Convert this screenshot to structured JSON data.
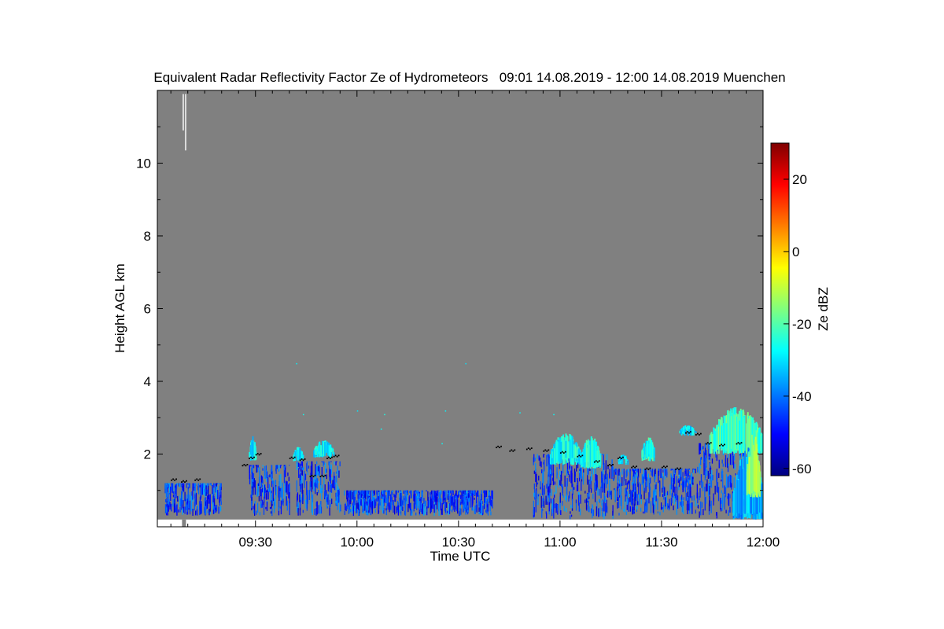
{
  "chart_data": {
    "type": "heatmap",
    "title": "Equivalent Radar Reflectivity Factor Ze of Hydrometeors   09:01 14.08.2019 - 12:00 14.08.2019 Muenchen",
    "xlabel": "Time UTC",
    "ylabel": "Height AGL km",
    "x_ticks": [
      "09:30",
      "10:00",
      "10:30",
      "11:00",
      "11:30",
      "12:00"
    ],
    "x_tick_minutes": [
      570,
      600,
      630,
      660,
      690,
      720
    ],
    "xlim_minutes": [
      541,
      720
    ],
    "y_ticks": [
      2,
      4,
      6,
      8,
      10
    ],
    "ylim": [
      0,
      12
    ],
    "background_color": "#808080",
    "colorbar": {
      "label": "Ze dBZ",
      "range": [
        -62,
        30
      ],
      "ticks": [
        -60,
        -40,
        -20,
        0,
        20
      ],
      "colors": [
        "#00007f",
        "#0000ff",
        "#007fff",
        "#00ffff",
        "#7fff7f",
        "#ffff00",
        "#ff7f00",
        "#ff0000",
        "#7f0000"
      ]
    },
    "echo_features": [
      {
        "t0": 568,
        "t1": 570,
        "h0": 1.8,
        "h1": 2.5,
        "dbz": -28
      },
      {
        "t0": 581,
        "t1": 584,
        "h0": 1.8,
        "h1": 2.2,
        "dbz": -30
      },
      {
        "t0": 587,
        "t1": 593,
        "h0": 1.9,
        "h1": 2.4,
        "dbz": -28
      },
      {
        "t0": 657,
        "t1": 666,
        "h0": 1.7,
        "h1": 2.6,
        "dbz": -27
      },
      {
        "t0": 666,
        "t1": 672,
        "h0": 1.6,
        "h1": 2.5,
        "dbz": -26
      },
      {
        "t0": 677,
        "t1": 680,
        "h0": 1.7,
        "h1": 2.0,
        "dbz": -32
      },
      {
        "t0": 684,
        "t1": 688,
        "h0": 1.8,
        "h1": 2.5,
        "dbz": -25
      },
      {
        "t0": 695,
        "t1": 700,
        "h0": 2.5,
        "h1": 2.8,
        "dbz": -30
      },
      {
        "t0": 704,
        "t1": 720,
        "h0": 2.0,
        "h1": 3.3,
        "dbz": -22
      },
      {
        "t0": 711,
        "t1": 720,
        "h0": 0.2,
        "h1": 2.2,
        "dbz": -35
      },
      {
        "t0": 715,
        "t1": 719,
        "h0": 0.8,
        "h1": 2.6,
        "dbz": -15
      }
    ],
    "drizzle_regions": [
      {
        "t0": 543,
        "t1": 560,
        "h0": 0.3,
        "h1": 1.2
      },
      {
        "t0": 568,
        "t1": 580,
        "h0": 0.3,
        "h1": 1.7
      },
      {
        "t0": 582,
        "t1": 595,
        "h0": 0.3,
        "h1": 1.8
      },
      {
        "t0": 596,
        "t1": 640,
        "h0": 0.3,
        "h1": 1.0
      },
      {
        "t0": 652,
        "t1": 676,
        "h0": 0.2,
        "h1": 2.0
      },
      {
        "t0": 676,
        "t1": 700,
        "h0": 0.3,
        "h1": 1.6
      },
      {
        "t0": 700,
        "t1": 715,
        "h0": 0.2,
        "h1": 2.3
      }
    ],
    "cloud_base": [
      {
        "t": 545,
        "h": 1.3
      },
      {
        "t": 548,
        "h": 1.25
      },
      {
        "t": 552,
        "h": 1.3
      },
      {
        "t": 566,
        "h": 1.7
      },
      {
        "t": 568,
        "h": 1.9
      },
      {
        "t": 570,
        "h": 2.0
      },
      {
        "t": 580,
        "h": 1.9
      },
      {
        "t": 583,
        "h": 1.85
      },
      {
        "t": 586,
        "h": 1.4
      },
      {
        "t": 589,
        "h": 1.4
      },
      {
        "t": 591,
        "h": 1.9
      },
      {
        "t": 593,
        "h": 1.95
      },
      {
        "t": 641,
        "h": 2.2
      },
      {
        "t": 645,
        "h": 2.1
      },
      {
        "t": 650,
        "h": 2.15
      },
      {
        "t": 655,
        "h": 2.1
      },
      {
        "t": 660,
        "h": 2.05
      },
      {
        "t": 665,
        "h": 1.95
      },
      {
        "t": 670,
        "h": 1.8
      },
      {
        "t": 674,
        "h": 1.7
      },
      {
        "t": 677,
        "h": 1.9
      },
      {
        "t": 681,
        "h": 1.65
      },
      {
        "t": 685,
        "h": 1.6
      },
      {
        "t": 690,
        "h": 1.65
      },
      {
        "t": 694,
        "h": 1.6
      },
      {
        "t": 697,
        "h": 2.6
      },
      {
        "t": 700,
        "h": 2.55
      },
      {
        "t": 703,
        "h": 2.3
      },
      {
        "t": 707,
        "h": 2.25
      },
      {
        "t": 712,
        "h": 2.3
      }
    ],
    "lowest_range_gate_km": 0.2
  }
}
